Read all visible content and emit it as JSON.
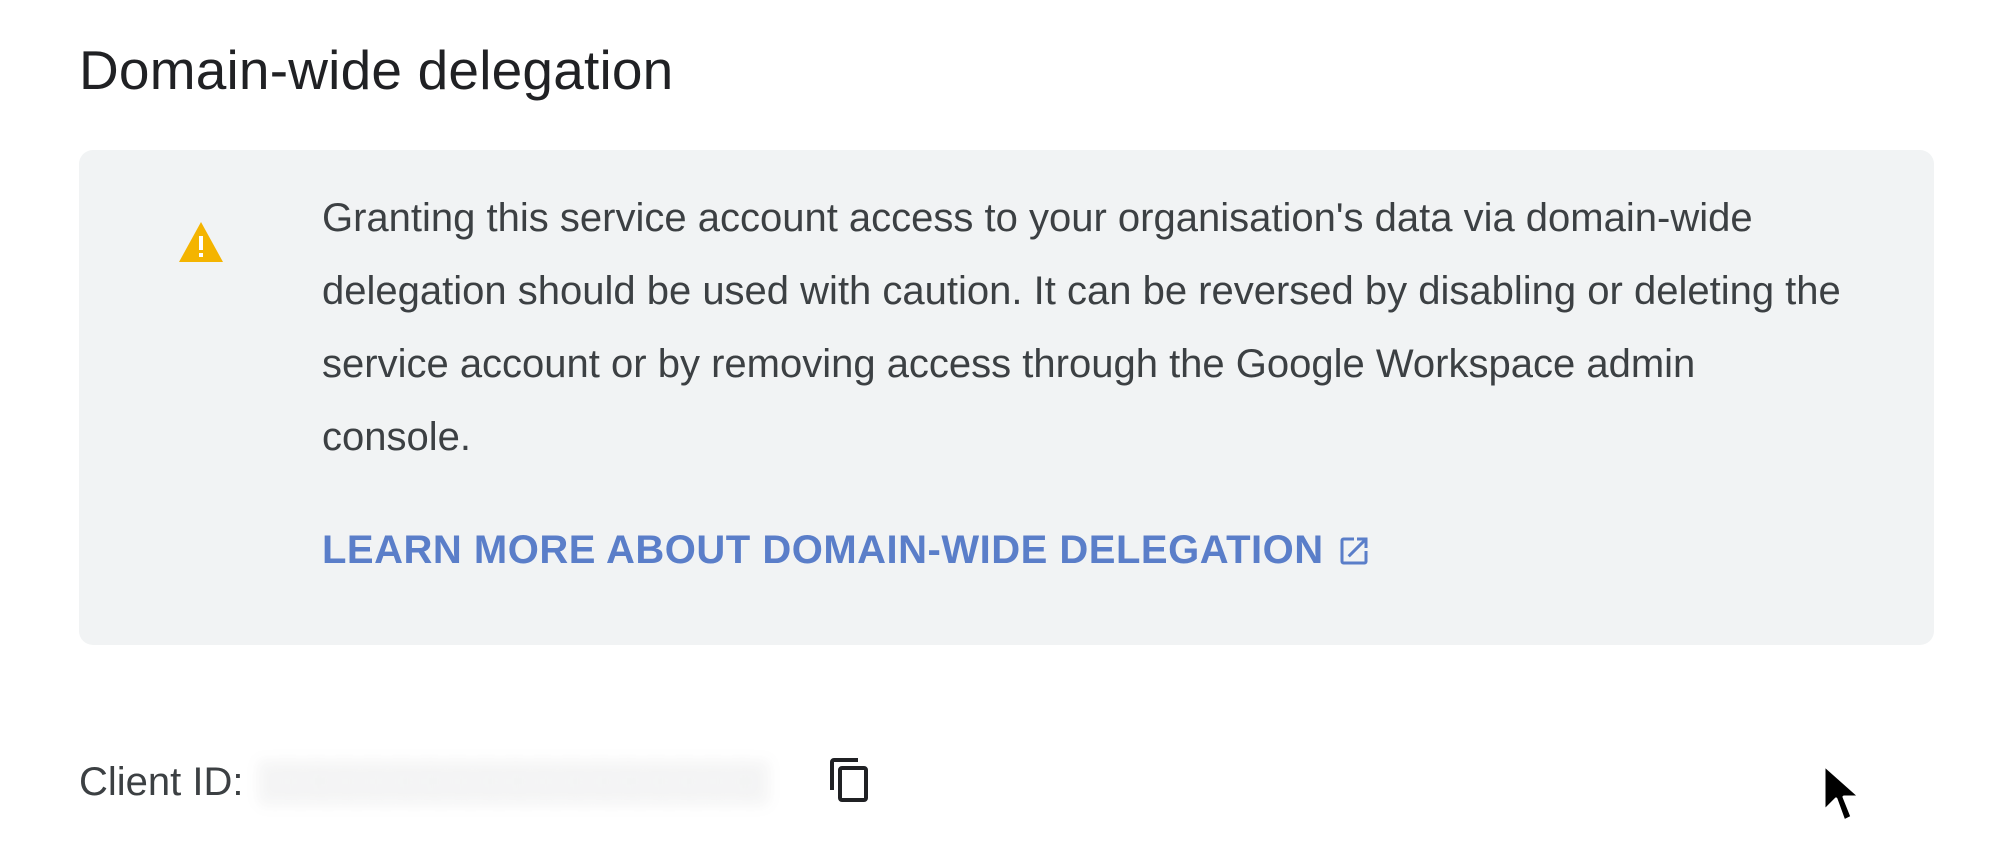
{
  "section": {
    "title": "Domain-wide delegation"
  },
  "warning": {
    "icon": "warning-icon",
    "icon_color": "#f4b400",
    "text": "Granting this service account access to your organisation's data via domain-wide delegation should be used with caution. It can be reversed by disabling or deleting the service account or by removing access through the Google Workspace admin console.",
    "link_label": "LEARN MORE ABOUT DOMAIN-WIDE DELEGATION",
    "link_icon": "external-link-icon",
    "link_color": "#5a7ec9",
    "background": "#f1f3f4"
  },
  "client": {
    "label": "Client ID:",
    "value_redacted": true,
    "copy_icon": "copy-icon"
  }
}
